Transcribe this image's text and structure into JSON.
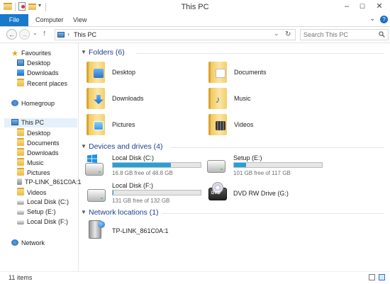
{
  "window": {
    "title": "This PC",
    "min_label": "–",
    "max_label": "☐",
    "close_label": "✕"
  },
  "ribbon": {
    "tabs": [
      {
        "label": "File"
      },
      {
        "label": "Computer"
      },
      {
        "label": "View"
      }
    ],
    "expand_label": "⌄",
    "help_label": "?"
  },
  "address": {
    "back_label": "←",
    "forward_label": "→",
    "history_label": "⌄",
    "up_label": "↑",
    "separator": "›",
    "path": "This PC",
    "refresh_label": "↻",
    "dropdown_label": "⌄"
  },
  "search": {
    "placeholder": "Search This PC",
    "icon": "magnifier"
  },
  "nav": {
    "favourites": {
      "label": "Favourites",
      "items": [
        {
          "label": "Desktop"
        },
        {
          "label": "Downloads"
        },
        {
          "label": "Recent places"
        }
      ]
    },
    "homegroup": {
      "label": "Homegroup"
    },
    "thispc": {
      "label": "This PC",
      "items": [
        {
          "label": "Desktop"
        },
        {
          "label": "Documents"
        },
        {
          "label": "Downloads"
        },
        {
          "label": "Music"
        },
        {
          "label": "Pictures"
        },
        {
          "label": "TP-LINK_861C0A:1"
        },
        {
          "label": "Videos"
        },
        {
          "label": "Local Disk (C:)"
        },
        {
          "label": "Setup (E:)"
        },
        {
          "label": "Local Disk (F:)"
        }
      ]
    },
    "network": {
      "label": "Network"
    }
  },
  "content": {
    "folders": {
      "title": "Folders (6)",
      "items": [
        {
          "label": "Desktop"
        },
        {
          "label": "Documents"
        },
        {
          "label": "Downloads"
        },
        {
          "label": "Music"
        },
        {
          "label": "Pictures"
        },
        {
          "label": "Videos"
        }
      ]
    },
    "drives": {
      "title": "Devices and drives (4)",
      "items": [
        {
          "label": "Local Disk (C:)",
          "free": "16.8 GB free of 48.8 GB",
          "used_fraction": 0.66
        },
        {
          "label": "Setup (E:)",
          "free": "101 GB free of 117 GB",
          "used_fraction": 0.14
        },
        {
          "label": "Local Disk (F:)",
          "free": "131 GB free of 132 GB",
          "used_fraction": 0.01
        },
        {
          "label": "DVD RW Drive (G:)"
        }
      ]
    },
    "network": {
      "title": "Network locations (1)",
      "items": [
        {
          "label": "TP-LINK_861C0A:1"
        }
      ]
    }
  },
  "status": {
    "count": "11 items"
  },
  "colors": {
    "accent": "#1979ca",
    "bar_fill": "#26a0da",
    "section_title": "#1e3f8a",
    "selection": "#e5f0fb"
  }
}
